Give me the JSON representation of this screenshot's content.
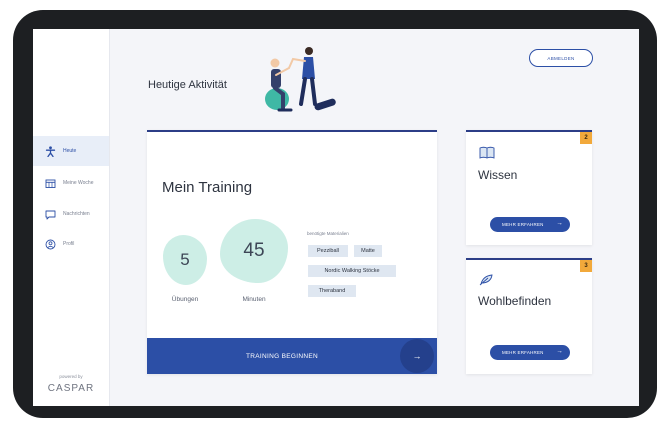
{
  "sidebar": {
    "items": [
      {
        "label": "Heute",
        "icon": "person-run-icon",
        "active": true
      },
      {
        "label": "Meine Woche",
        "icon": "calendar-icon",
        "active": false
      },
      {
        "label": "Nachrichten",
        "icon": "message-icon",
        "active": false
      },
      {
        "label": "Profil",
        "icon": "profile-icon",
        "active": false
      }
    ],
    "powered_by": "powered by",
    "brand": "CASPAR"
  },
  "header": {
    "title": "Heutige Aktivität",
    "logout_label": "ABMELDEN"
  },
  "training": {
    "title": "Mein Training",
    "exercises_value": "5",
    "exercises_label": "Übungen",
    "minutes_value": "45",
    "minutes_label": "Minuten",
    "materials_title": "benötigte Materialien",
    "materials": [
      "Pezziball",
      "Matte",
      "Nordic Walking Stöcke",
      "Theraband"
    ],
    "start_label": "TRAINING BEGINNEN",
    "start_arrow": "→"
  },
  "cards": [
    {
      "title": "Wissen",
      "badge": "2",
      "button": "MEHR ERFAHREN",
      "arrow": "→",
      "icon": "book-icon"
    },
    {
      "title": "Wohlbefinden",
      "badge": "3",
      "button": "MEHR ERFAHREN",
      "arrow": "→",
      "icon": "leaf-icon"
    }
  ],
  "colors": {
    "primary": "#2c4fa6",
    "accent_badge": "#f2a93b",
    "blob": "#cdeee6",
    "background": "#f4f5f9"
  }
}
